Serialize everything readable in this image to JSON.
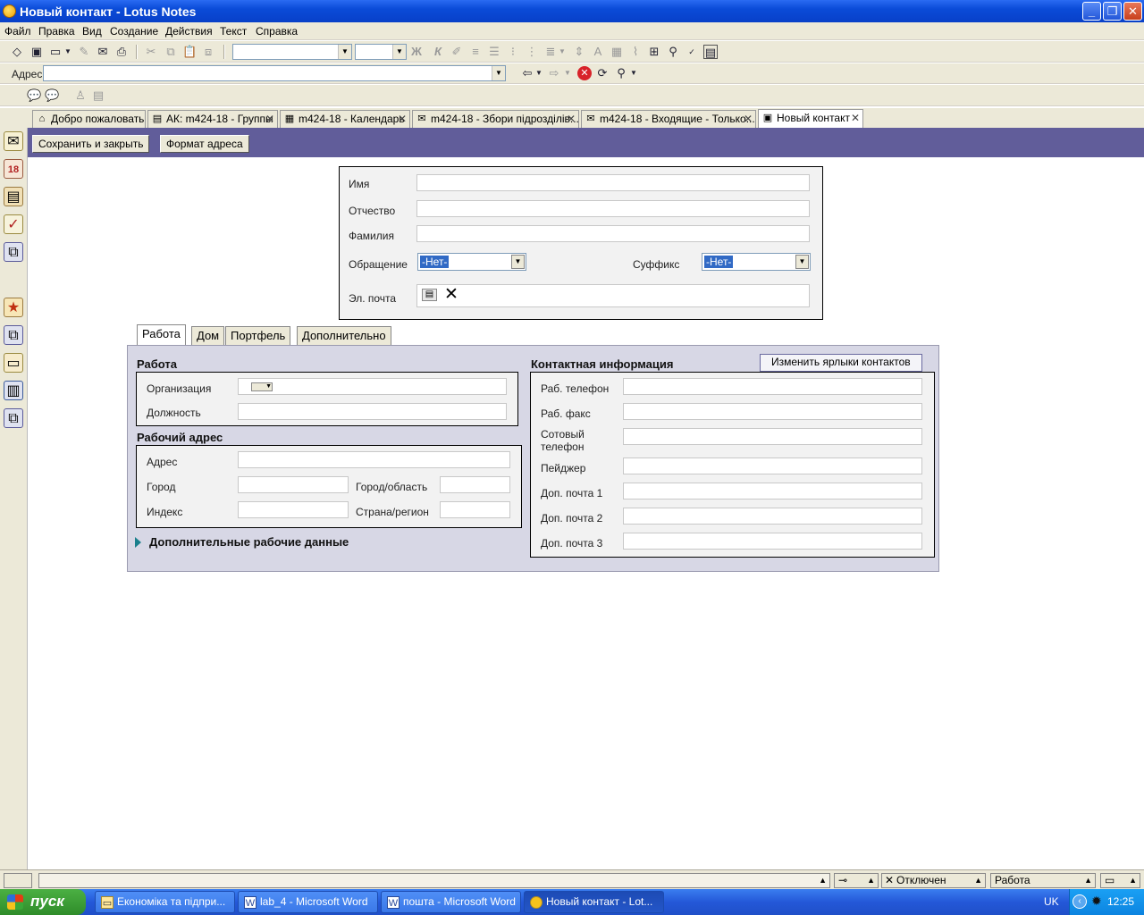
{
  "window": {
    "title": "Новый контакт - Lotus Notes"
  },
  "menu": [
    "Файл",
    "Правка",
    "Вид",
    "Создание",
    "Действия",
    "Текст",
    "Справка"
  ],
  "address_bar": {
    "label": "Адрес",
    "value": ""
  },
  "format_toolbar": {
    "bold_label": "Ж",
    "italic_label": "К"
  },
  "tabs": [
    {
      "label": "Добро пожаловать",
      "icon": "home-icon"
    },
    {
      "label": "АК: m424-18 - Группы",
      "icon": "contacts-icon"
    },
    {
      "label": "m424-18 - Календарь",
      "icon": "calendar-icon"
    },
    {
      "label": "m424-18 - Збори підрозділів...",
      "icon": "mail-icon"
    },
    {
      "label": "m424-18 - Входящие - Только...",
      "icon": "mail-icon"
    },
    {
      "label": "Новый контакт",
      "icon": "contact-card-icon"
    }
  ],
  "actions": {
    "save_close": "Сохранить и закрыть",
    "address_format": "Формат адреса"
  },
  "name_form": {
    "first_name": {
      "label": "Имя",
      "value": ""
    },
    "middle_name": {
      "label": "Отчество",
      "value": ""
    },
    "last_name": {
      "label": "Фамилия",
      "value": ""
    },
    "salutation": {
      "label": "Обращение",
      "value": "-Нет-"
    },
    "suffix": {
      "label": "Суффикс",
      "value": "-Нет-"
    },
    "email": {
      "label": "Эл. почта",
      "value": ""
    }
  },
  "form_tabs": [
    "Работа",
    "Дом",
    "Портфель",
    "Дополнительно"
  ],
  "work": {
    "title": "Работа",
    "organization": {
      "label": "Организация",
      "value": ""
    },
    "position": {
      "label": "Должность",
      "value": ""
    }
  },
  "work_address": {
    "title": "Рабочий адрес",
    "address": {
      "label": "Адрес",
      "value": ""
    },
    "city": {
      "label": "Город",
      "value": ""
    },
    "state": {
      "label": "Город/область",
      "value": ""
    },
    "zip": {
      "label": "Индекс",
      "value": ""
    },
    "country": {
      "label": "Страна/регион",
      "value": ""
    }
  },
  "extra_work": {
    "label": "Дополнительные рабочие данные"
  },
  "contact_info": {
    "title": "Контактная информация",
    "edit_labels": "Изменить ярлыки контактов",
    "rows": [
      {
        "label": "Раб. телефон",
        "value": ""
      },
      {
        "label": "Раб. факс",
        "value": ""
      },
      {
        "label": "Сотовый телефон",
        "value": ""
      },
      {
        "label": "Пейджер",
        "value": ""
      },
      {
        "label": "Доп. почта 1",
        "value": ""
      },
      {
        "label": "Доп. почта 2",
        "value": ""
      },
      {
        "label": "Доп. почта 3",
        "value": ""
      }
    ]
  },
  "status": {
    "online": "Отключен",
    "location": "Работа"
  },
  "taskbar": {
    "start": "пуск",
    "items": [
      {
        "label": "Економіка та підпри...",
        "icon": "folder-icon"
      },
      {
        "label": "lab_4 - Microsoft Word",
        "icon": "word-icon"
      },
      {
        "label": "пошта - Microsoft Word",
        "icon": "word-icon"
      },
      {
        "label": "Новый контакт - Lot...",
        "icon": "lotus-icon"
      }
    ],
    "lang": "UK",
    "time": "12:25"
  }
}
